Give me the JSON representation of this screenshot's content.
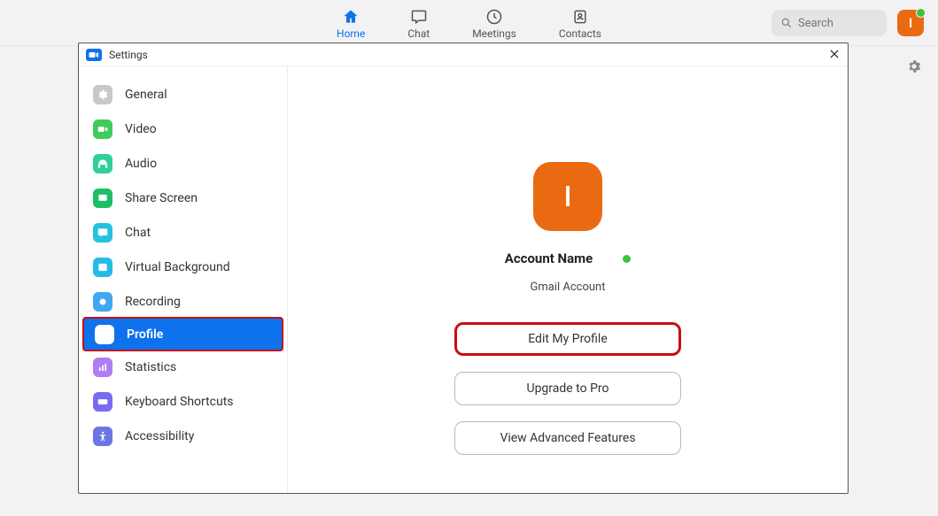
{
  "nav": {
    "tabs": [
      {
        "label": "Home",
        "active": true
      },
      {
        "label": "Chat",
        "active": false
      },
      {
        "label": "Meetings",
        "active": false
      },
      {
        "label": "Contacts",
        "active": false
      }
    ]
  },
  "search": {
    "placeholder": "Search"
  },
  "avatar": {
    "initial": "I"
  },
  "settings": {
    "window_title": "Settings",
    "sidebar": [
      {
        "label": "General"
      },
      {
        "label": "Video"
      },
      {
        "label": "Audio"
      },
      {
        "label": "Share Screen"
      },
      {
        "label": "Chat"
      },
      {
        "label": "Virtual Background"
      },
      {
        "label": "Recording"
      },
      {
        "label": "Profile",
        "active": true
      },
      {
        "label": "Statistics"
      },
      {
        "label": "Keyboard Shortcuts"
      },
      {
        "label": "Accessibility"
      }
    ],
    "profile": {
      "avatar_initial": "I",
      "account_name": "Account Name",
      "account_sub": "Gmail Account",
      "buttons": {
        "edit": "Edit My Profile",
        "upgrade": "Upgrade to Pro",
        "advanced": "View Advanced Features"
      }
    }
  },
  "colors": {
    "brand_blue": "#0e72ed",
    "accent_orange": "#ea6a12",
    "highlight_red": "#c90e0e",
    "presence_green": "#3ec13e"
  }
}
